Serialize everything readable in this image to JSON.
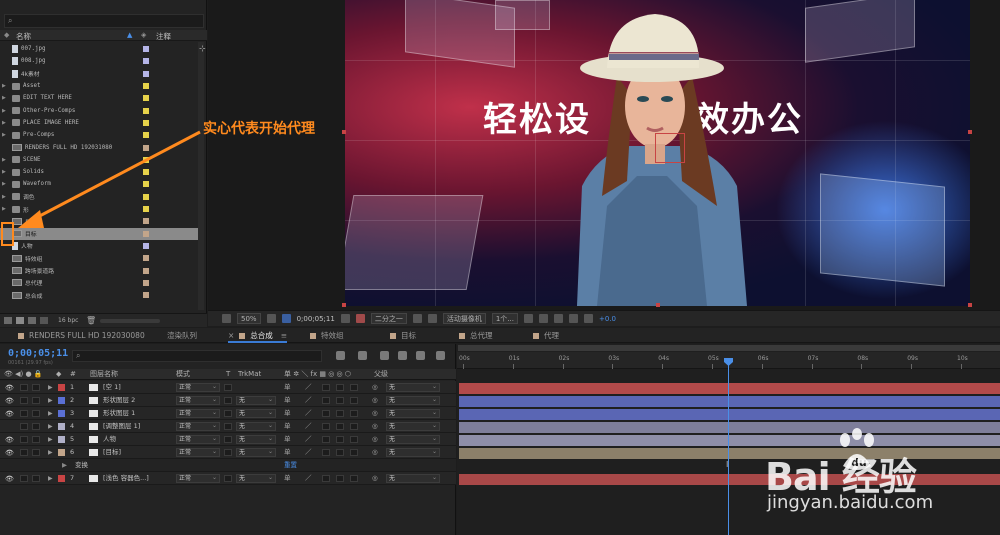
{
  "project": {
    "columns": {
      "name": "名称",
      "comment": "注释"
    },
    "items": [
      {
        "name": "007.jpg",
        "kind": "file",
        "color": "#b4b4e6"
      },
      {
        "name": "008.jpg",
        "kind": "file",
        "color": "#b4b4e6"
      },
      {
        "name": "4k素材",
        "kind": "file",
        "color": "#b4b4e6"
      },
      {
        "name": "Asset",
        "kind": "folder",
        "color": "#e6d24a"
      },
      {
        "name": "EDIT TEXT HERE",
        "kind": "folder",
        "color": "#e6d24a"
      },
      {
        "name": "Other-Pre-Comps",
        "kind": "folder",
        "color": "#e6d24a"
      },
      {
        "name": "PLACE IMAGE HERE",
        "kind": "folder",
        "color": "#e6d24a"
      },
      {
        "name": "Pre-Comps",
        "kind": "folder",
        "color": "#e6d24a"
      },
      {
        "name": "RENDERS FULL HD 192031080",
        "kind": "comp",
        "color": "#c2a58a"
      },
      {
        "name": "SCENE",
        "kind": "folder",
        "color": "#e6d24a"
      },
      {
        "name": "Solids",
        "kind": "folder",
        "color": "#e6d24a"
      },
      {
        "name": "Waveform",
        "kind": "folder",
        "color": "#e6d24a"
      },
      {
        "name": "调色",
        "kind": "folder",
        "color": "#e6d24a"
      },
      {
        "name": "形",
        "kind": "folder",
        "color": "#e6d24a"
      },
      {
        "name": "目",
        "kind": "comp",
        "color": "#c2a58a"
      },
      {
        "name": "目标",
        "kind": "comp",
        "color": "#c2a58a",
        "selected": true
      },
      {
        "name": "人物",
        "kind": "file",
        "color": "#b4b4e6"
      },
      {
        "name": "特效组",
        "kind": "comp",
        "color": "#c2a58a"
      },
      {
        "name": "跨场景道路",
        "kind": "comp",
        "color": "#c2a58a"
      },
      {
        "name": "总代理",
        "kind": "comp",
        "color": "#c2a58a"
      },
      {
        "name": "总合成",
        "kind": "comp",
        "color": "#c2a58a"
      }
    ],
    "footer_bpc": "16 bpc"
  },
  "viewer": {
    "title_text": "轻松设",
    "title_text2": "效办公",
    "zoom": "50%",
    "timecode": "0;00;05;11",
    "resolution": "二分之一",
    "camera": "活动摄像机",
    "views": "1个...",
    "exposure": "+0.0"
  },
  "tabs": [
    {
      "label": "RENDERS FULL HD 192030080",
      "color": "#c2a58a"
    },
    {
      "label": "渲染队列",
      "color": ""
    },
    {
      "label": "总合成",
      "color": "#c2a58a",
      "active": true
    },
    {
      "label": "特效组",
      "color": "#c2a58a"
    },
    {
      "label": "目标",
      "color": "#c2a58a"
    },
    {
      "label": "总代理",
      "color": "#c2a58a"
    },
    {
      "label": "代理",
      "color": "#c2a58a"
    }
  ],
  "timeline": {
    "timecode": "0;00;05;11",
    "fps": "00161 (29.97 fps)",
    "columns": {
      "name": "图层名称",
      "mode": "模式",
      "t": "T",
      "trkmat": "TrkMat",
      "parent": "父级"
    },
    "layers": [
      {
        "num": "1",
        "name": "[空 1]",
        "mode": "正常",
        "trk": "",
        "parent": "无",
        "label": "#c84444",
        "bar": "#b24a4a",
        "eye": true
      },
      {
        "num": "2",
        "name": "形状图层 2",
        "mode": "正常",
        "trk": "无",
        "parent": "无",
        "label": "#5a6fd4",
        "bar": "#5a66b4",
        "eye": true
      },
      {
        "num": "3",
        "name": "形状图层 1",
        "mode": "正常",
        "trk": "无",
        "parent": "无",
        "label": "#5a6fd4",
        "bar": "#5a66b4",
        "eye": true
      },
      {
        "num": "4",
        "name": "[调整图层 1]",
        "mode": "正常",
        "trk": "无",
        "parent": "无",
        "label": "#b0b0c8",
        "bar": "#7e7e9a",
        "eye": false
      },
      {
        "num": "5",
        "name": "人物",
        "mode": "正常",
        "trk": "无",
        "parent": "无",
        "label": "#b0b0c8",
        "bar": "#8e8ea8",
        "eye": true
      },
      {
        "num": "6",
        "name": "[目标]",
        "mode": "正常",
        "trk": "无",
        "parent": "无",
        "label": "#c2a58a",
        "bar": "#8c806a",
        "eye": true
      },
      {
        "num": "7",
        "name": "[浅色 容器色...]",
        "mode": "正常",
        "trk": "无",
        "parent": "无",
        "label": "#c84444",
        "bar": "#a84848",
        "eye": true
      }
    ],
    "sub_row": {
      "label": "变换",
      "value": "重置"
    },
    "ruler": [
      "00s",
      "01s",
      "02s",
      "03s",
      "04s",
      "05s",
      "06s",
      "07s",
      "08s",
      "09s",
      "10s"
    ]
  },
  "annotation": {
    "text": "实心代表开始代理"
  },
  "watermark": {
    "logo": "Bai  经验",
    "url": "jingyan.baidu.com"
  }
}
